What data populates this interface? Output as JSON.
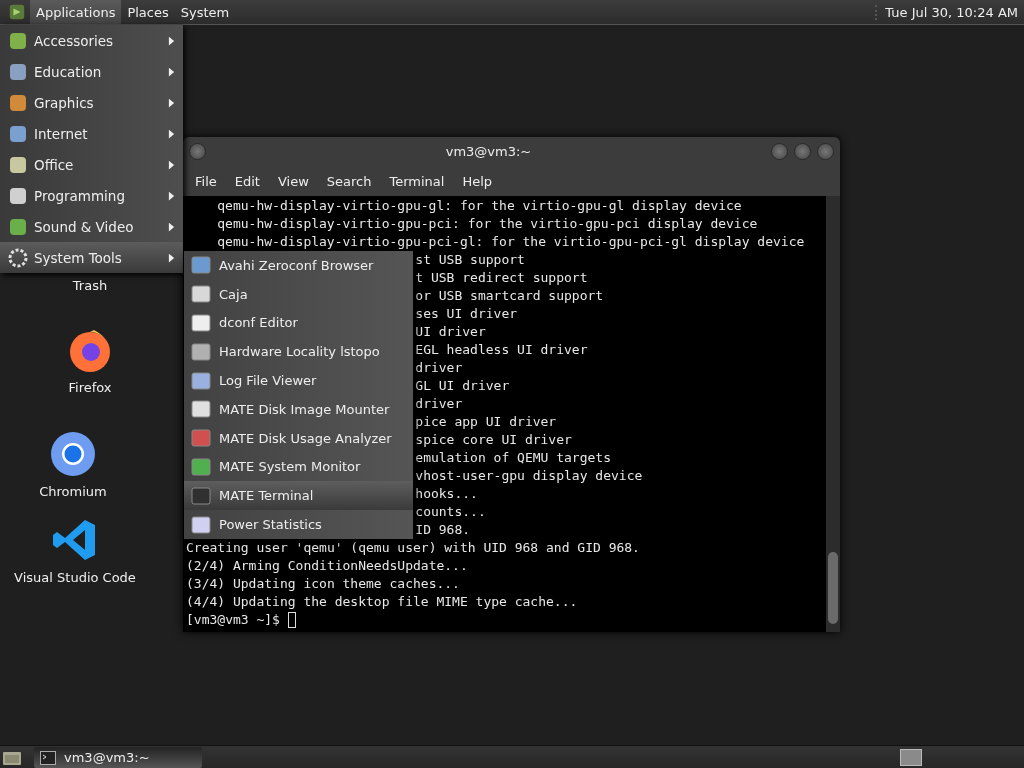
{
  "top_panel": {
    "menus": [
      {
        "label": "Applications",
        "selected": true
      },
      {
        "label": "Places",
        "selected": false
      },
      {
        "label": "System",
        "selected": false
      }
    ],
    "clock": "Tue Jul 30, 10:24 AM"
  },
  "desktop_icons": [
    {
      "label": "Trash",
      "kind": "trash"
    },
    {
      "label": "Firefox",
      "kind": "firefox"
    },
    {
      "label": "Chromium",
      "kind": "chromium"
    },
    {
      "label": "Visual Studio Code",
      "kind": "vscode"
    }
  ],
  "terminal_window": {
    "title": "vm3@vm3:~",
    "menu": [
      "File",
      "Edit",
      "View",
      "Search",
      "Terminal",
      "Help"
    ],
    "lines": [
      {
        "text": "qemu-hw-display-virtio-gpu-gl: for the virtio-gpu-gl display device",
        "kind": "indented"
      },
      {
        "text": "qemu-hw-display-virtio-gpu-pci: for the virtio-gpu-pci display device",
        "kind": "indented"
      },
      {
        "text": "qemu-hw-display-virtio-gpu-pci-gl: for the virtio-gpu-pci-gl display device",
        "kind": "indented"
      },
      {
        "text": "st USB support",
        "kind": "fragment"
      },
      {
        "text": "t USB redirect support",
        "kind": "fragment"
      },
      {
        "text": "or USB smartcard support",
        "kind": "fragment"
      },
      {
        "text": "ses UI driver",
        "kind": "fragment"
      },
      {
        "text": "UI driver",
        "kind": "fragment"
      },
      {
        "text": "EGL headless UI driver",
        "kind": "fragment"
      },
      {
        "text": "driver",
        "kind": "fragment"
      },
      {
        "text": "GL UI driver",
        "kind": "fragment"
      },
      {
        "text": "driver",
        "kind": "fragment"
      },
      {
        "text": "pice app UI driver",
        "kind": "fragment"
      },
      {
        "text": "spice core UI driver",
        "kind": "fragment"
      },
      {
        "text": "emulation of QEMU targets",
        "kind": "fragment"
      },
      {
        "text": "vhost-user-gpu display device",
        "kind": "fragment"
      },
      {
        "text": "hooks...",
        "kind": "fragment"
      },
      {
        "text": "counts...",
        "kind": "fragment"
      },
      {
        "text": "ID 968.",
        "kind": "fragment"
      },
      {
        "text": "Creating user 'qemu' (qemu user) with UID 968 and GID 968.",
        "kind": "plain"
      },
      {
        "text": "(2/4) Arming ConditionNeedsUpdate...",
        "kind": "plain"
      },
      {
        "text": "(3/4) Updating icon theme caches...",
        "kind": "plain"
      },
      {
        "text": "(4/4) Updating the desktop file MIME type cache...",
        "kind": "plain"
      }
    ],
    "prompt": "[vm3@vm3 ~]$"
  },
  "applications_menu": {
    "items": [
      {
        "label": "Accessories",
        "selected": false
      },
      {
        "label": "Education",
        "selected": false
      },
      {
        "label": "Graphics",
        "selected": false
      },
      {
        "label": "Internet",
        "selected": false
      },
      {
        "label": "Office",
        "selected": false
      },
      {
        "label": "Programming",
        "selected": false
      },
      {
        "label": "Sound & Video",
        "selected": false
      },
      {
        "label": "System Tools",
        "selected": true
      }
    ]
  },
  "system_tools_submenu": {
    "items": [
      {
        "label": "Avahi Zeroconf Browser",
        "selected": false
      },
      {
        "label": "Caja",
        "selected": false
      },
      {
        "label": "dconf Editor",
        "selected": false
      },
      {
        "label": "Hardware Locality lstopo",
        "selected": false
      },
      {
        "label": "Log File Viewer",
        "selected": false
      },
      {
        "label": "MATE Disk Image Mounter",
        "selected": false
      },
      {
        "label": "MATE Disk Usage Analyzer",
        "selected": false
      },
      {
        "label": "MATE System Monitor",
        "selected": false
      },
      {
        "label": "MATE Terminal",
        "selected": true
      },
      {
        "label": "Power Statistics",
        "selected": false
      }
    ]
  },
  "taskbar": {
    "buttons": [
      {
        "label": "vm3@vm3:~",
        "selected": true
      }
    ]
  }
}
